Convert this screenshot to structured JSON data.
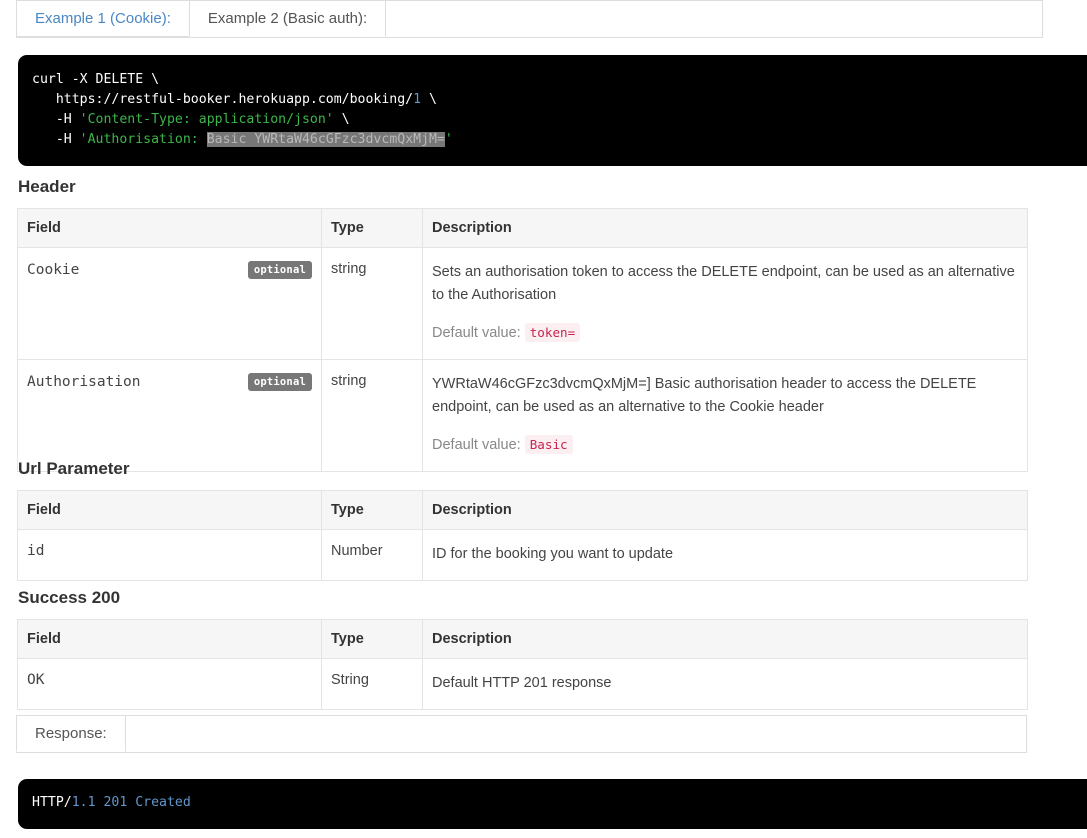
{
  "examples_tabs": [
    {
      "label": "Example 1 (Cookie):",
      "active": false
    },
    {
      "label": "Example 2 (Basic auth):",
      "active": true
    }
  ],
  "request_code": {
    "line1_cmd": "curl -X DELETE \\",
    "line2_url": "https://restful-booker.herokuapp.com/booking/",
    "line2_id": "1",
    "line2_tail": " \\",
    "line3_flag": "-H ",
    "line3_string": "'Content-Type: application/json'",
    "line3_tail": " \\",
    "line4_flag": "-H ",
    "line4_string_open": "'Authorisation: ",
    "line4_highlight": "Basic YWRtaW46cGFzc3dvcmQxMjM=",
    "line4_string_close": "'"
  },
  "sections": {
    "header": "Header",
    "url_parameter": "Url Parameter",
    "success_200": "Success 200"
  },
  "table_columns": {
    "field": "Field",
    "type": "Type",
    "description": "Description"
  },
  "header_table": {
    "rows": [
      {
        "field": "Cookie",
        "badge": "optional",
        "type": "string",
        "description": "Sets an authorisation token to access the DELETE endpoint, can be used as an alternative to the Authorisation",
        "default_label": "Default value:",
        "default_value": "token="
      },
      {
        "field": "Authorisation",
        "badge": "optional",
        "type": "string",
        "description": "YWRtaW46cGFzc3dvcmQxMjM=] Basic authorisation header to access the DELETE endpoint, can be used as an alternative to the Cookie header",
        "default_label": "Default value:",
        "default_value": "Basic"
      }
    ]
  },
  "url_parameter_table": {
    "rows": [
      {
        "field": "id",
        "type": "Number",
        "description": "ID for the booking you want to update"
      }
    ]
  },
  "success_table": {
    "rows": [
      {
        "field": "OK",
        "type": "String",
        "description": "Default HTTP 201 response"
      }
    ]
  },
  "response_tabs": [
    {
      "label": "Response:",
      "active": true
    }
  ],
  "response_code": {
    "proto": "HTTP/",
    "status": "1.1 201 Created"
  },
  "colors": {
    "link": "#4a87c4",
    "code_bg": "#000000",
    "code_string": "#3cb54a",
    "code_number": "#6196cc",
    "badge_bg": "#777777",
    "inline_code_fg": "#c7254e",
    "inline_code_bg": "#fbeff2",
    "table_header_bg": "#f6f6f6",
    "table_border": "#e4e4e4"
  }
}
